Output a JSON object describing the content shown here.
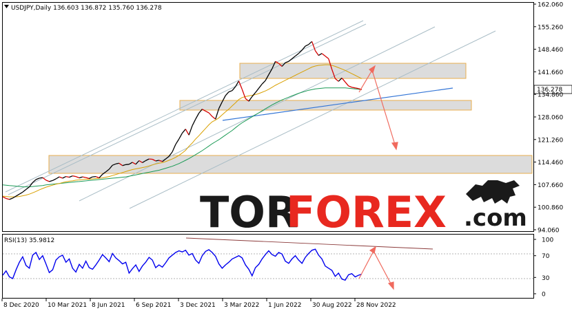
{
  "chart_data": [
    {
      "type": "line",
      "symbol": "USDJPY",
      "timeframe": "Daily",
      "header": "USDJPY,Daily  136.603 136.872 135.760 136.278",
      "ohlc": {
        "open": 136.603,
        "high": 136.872,
        "low": 135.76,
        "close": 136.278
      },
      "last_price_label": "136.278",
      "y_ticks": [
        "162.060",
        "155.260",
        "148.460",
        "141.660",
        "134.860",
        "128.060",
        "121.260",
        "114.460",
        "107.660",
        "100.860",
        "94.060"
      ],
      "x_ticks": [
        "8 Dec 2020",
        "10 Mar 2021",
        "8 Jun 2021",
        "6 Sep 2021",
        "3 Dec 2021",
        "3 Mar 2022",
        "1 Jun 2022",
        "30 Aug 2022",
        "28 Nov 2022"
      ],
      "ylim": [
        94.06,
        162.06
      ],
      "series": [
        {
          "values": [
            104.0,
            103.5,
            103.2,
            103.6,
            104.2,
            104.8,
            105.4,
            106.2,
            107.0,
            108.3,
            109.2,
            109.6,
            109.8,
            109.0,
            108.6,
            108.9,
            109.4,
            110.0,
            109.6,
            110.1,
            109.9,
            110.3,
            110.1,
            109.7,
            110.0,
            109.8,
            109.5,
            110.0,
            110.1,
            109.7,
            110.8,
            111.5,
            112.3,
            113.5,
            113.9,
            114.1,
            113.4,
            113.7,
            113.8,
            114.4,
            113.8,
            114.9,
            114.3,
            114.9,
            115.4,
            115.3,
            114.8,
            115.0,
            114.6,
            115.4,
            116.2,
            117.5,
            119.8,
            121.4,
            123.2,
            124.4,
            122.6,
            125.4,
            127.4,
            129.2,
            130.4,
            129.8,
            129.3,
            128.2,
            127.4,
            130.6,
            132.6,
            134.5,
            135.6,
            136.0,
            137.2,
            138.9,
            136.4,
            133.6,
            132.8,
            134.2,
            135.4,
            136.7,
            138.0,
            139.0,
            140.8,
            142.6,
            144.8,
            144.2,
            143.3,
            144.4,
            144.8,
            145.6,
            146.4,
            147.2,
            148.2,
            149.4,
            149.9,
            150.8,
            148.0,
            146.6,
            147.2,
            146.4,
            145.6,
            142.4,
            139.6,
            138.8,
            139.8,
            138.6,
            137.4,
            137.0,
            136.8,
            136.6,
            136.3
          ]
        },
        {
          "values": [
            104.2,
            104.1,
            104.0,
            104.0,
            104.0,
            104.1,
            104.3,
            104.5,
            104.8,
            105.2,
            105.6,
            106.1,
            106.5,
            106.9,
            107.2,
            107.5,
            107.8,
            108.0,
            108.3,
            108.5,
            108.7,
            108.8,
            109.0,
            109.1,
            109.2,
            109.3,
            109.3,
            109.4,
            109.5,
            109.6,
            109.7,
            109.9,
            110.1,
            110.4,
            110.7,
            111.0,
            111.3,
            111.6,
            111.9,
            112.2,
            112.4,
            112.6,
            112.8,
            113.0,
            113.3,
            113.6,
            113.9,
            114.1,
            114.3,
            114.6,
            115.0,
            115.4,
            115.9,
            116.5,
            117.2,
            118.0,
            119.2,
            120.2,
            121.4,
            122.4,
            123.5,
            124.6,
            125.7,
            126.6,
            127.1,
            127.8,
            128.7,
            129.6,
            130.4,
            131.4,
            132.3,
            133.3,
            133.9,
            134.2,
            134.4,
            134.6,
            134.8,
            135.1,
            135.5,
            135.9,
            136.4,
            137.0,
            137.6,
            138.1,
            138.6,
            139.1,
            139.6,
            140.1,
            140.6,
            141.1,
            141.6,
            142.1,
            142.6,
            143.1,
            143.4,
            143.6,
            143.7,
            143.8,
            143.8,
            143.6,
            143.3,
            142.9,
            142.5,
            142.1,
            141.6,
            141.1,
            140.6,
            140.1,
            139.6
          ]
        },
        {
          "values": [
            107.6,
            107.5,
            107.4,
            107.3,
            107.2,
            107.1,
            107.0,
            107.0,
            107.0,
            107.1,
            107.2,
            107.3,
            107.4,
            107.6,
            107.7,
            107.8,
            107.9,
            108.0,
            108.1,
            108.2,
            108.3,
            108.4,
            108.5,
            108.6,
            108.7,
            108.8,
            108.9,
            109.0,
            109.1,
            109.2,
            109.3,
            109.4,
            109.5,
            109.6,
            109.7,
            109.8,
            109.9,
            110.0,
            110.2,
            110.4,
            110.6,
            110.8,
            111.0,
            111.2,
            111.4,
            111.6,
            111.8,
            112.0,
            112.3,
            112.6,
            112.9,
            113.2,
            113.6,
            114.0,
            114.5,
            115.0,
            115.5,
            116.1,
            116.7,
            117.3,
            117.9,
            118.6,
            119.3,
            120.0,
            120.6,
            121.2,
            121.9,
            122.6,
            123.3,
            124.0,
            124.8,
            125.6,
            126.3,
            126.9,
            127.5,
            128.1,
            128.7,
            129.3,
            129.9,
            130.5,
            131.1,
            131.7,
            132.2,
            132.7,
            133.2,
            133.6,
            134.0,
            134.4,
            134.8,
            135.2,
            135.5,
            135.8,
            136.1,
            136.3,
            136.5,
            136.6,
            136.7,
            136.8,
            136.8,
            136.8,
            136.8,
            136.8,
            136.8,
            136.8,
            136.7,
            136.6,
            136.5,
            136.4,
            136.3
          ]
        }
      ]
    },
    {
      "type": "line",
      "title": "RSI(13) 35.9812",
      "y_ticks": [
        "100",
        "70",
        "30",
        "0"
      ],
      "ylim": [
        0,
        100
      ],
      "series": [
        {
          "values": [
            34,
            42,
            31,
            28,
            44,
            58,
            68,
            52,
            47,
            71,
            76,
            63,
            70,
            55,
            39,
            44,
            62,
            68,
            71,
            58,
            64,
            47,
            40,
            54,
            47,
            60,
            48,
            45,
            53,
            62,
            72,
            66,
            59,
            74,
            66,
            61,
            55,
            58,
            38,
            46,
            53,
            41,
            51,
            58,
            67,
            62,
            48,
            53,
            49,
            57,
            66,
            71,
            76,
            79,
            77,
            80,
            71,
            74,
            62,
            56,
            70,
            78,
            81,
            76,
            69,
            55,
            47,
            53,
            58,
            64,
            67,
            70,
            66,
            53,
            45,
            33,
            48,
            54,
            64,
            72,
            79,
            72,
            69,
            76,
            73,
            60,
            56,
            64,
            70,
            62,
            56,
            67,
            74,
            80,
            82,
            71,
            64,
            51,
            47,
            43,
            32,
            38,
            27,
            25,
            35,
            37,
            31,
            34,
            36
          ]
        }
      ]
    }
  ],
  "watermark": {
    "part1": "TOR",
    "part2": "FOREX",
    "part3": ".com"
  },
  "colors": {
    "price_up": "#000000",
    "price_down": "#d40000",
    "ma_fast": "#d9a000",
    "ma_slow": "#1a9a55",
    "rsi": "#0000ee",
    "zone_fill": "#d9d9d9",
    "zone_border": "#e6a63a",
    "trendline": "#3375d6",
    "channel": "#a9bdc6",
    "forecast_arrow": "#f06a5e",
    "watermark_red": "#e8281f"
  }
}
